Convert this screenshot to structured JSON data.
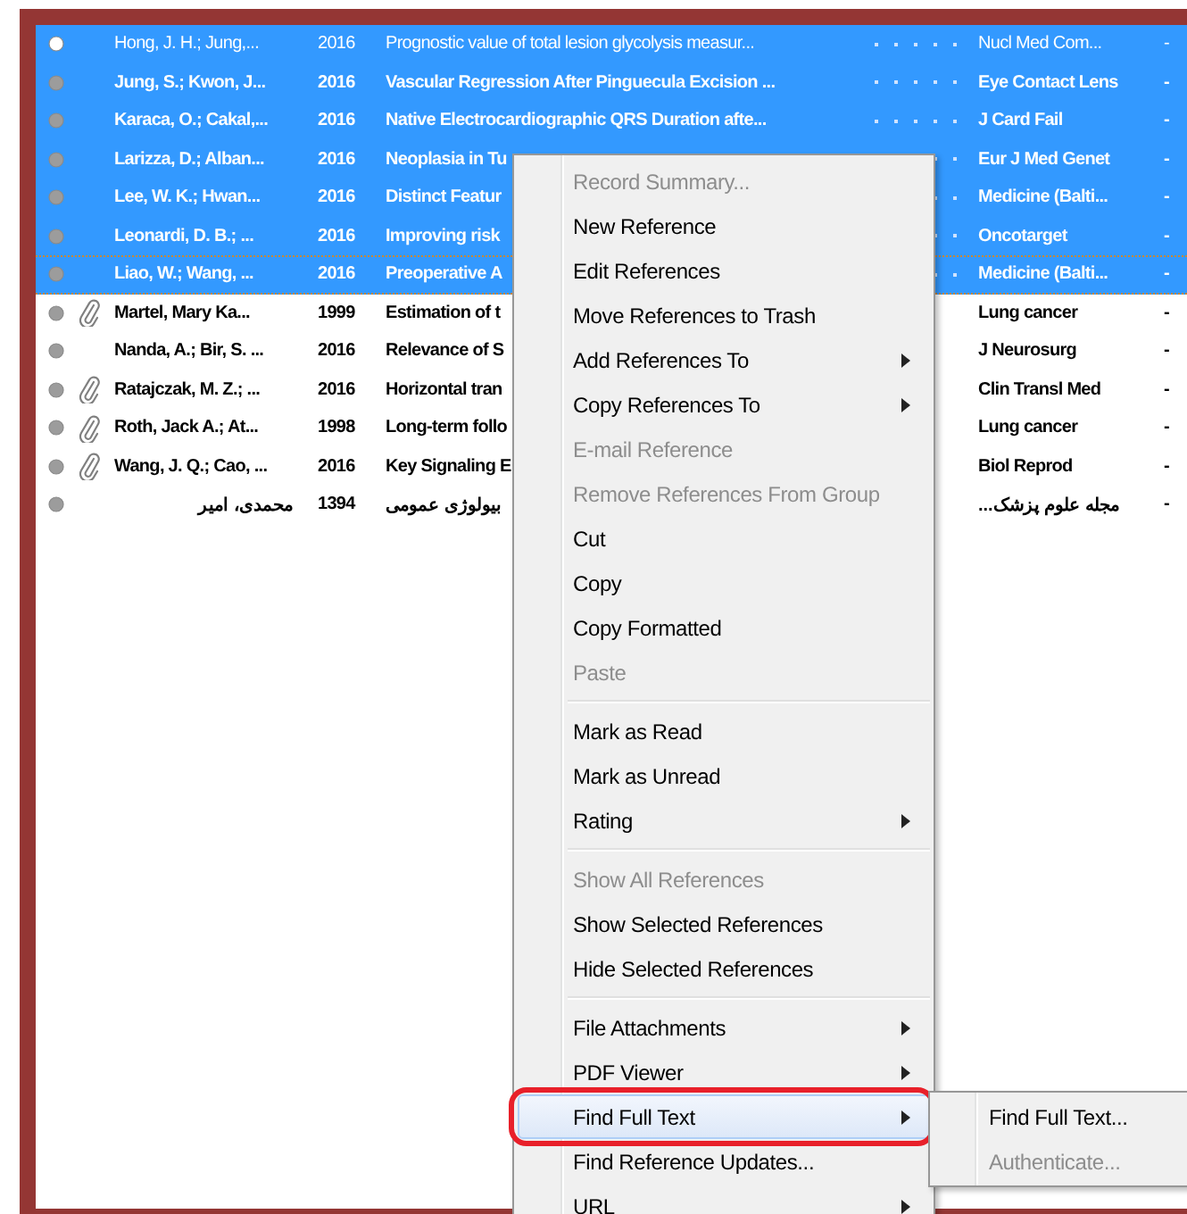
{
  "references": {
    "rows": [
      {
        "read": true,
        "attachment": false,
        "selected": true,
        "focused": false,
        "rtl": false,
        "author": "Hong, J. H.; Jung,...",
        "year": "2016",
        "title": "Prognostic value of total lesion glycolysis measur...",
        "journal": "Nucl Med Com...",
        "column_7": "-"
      },
      {
        "read": false,
        "attachment": false,
        "selected": true,
        "focused": false,
        "rtl": false,
        "author": "Jung, S.; Kwon, J...",
        "year": "2016",
        "title": "Vascular Regression After Pinguecula Excision ...",
        "journal": "Eye Contact Lens",
        "column_7": "-"
      },
      {
        "read": false,
        "attachment": false,
        "selected": true,
        "focused": false,
        "rtl": false,
        "author": "Karaca, O.; Cakal,...",
        "year": "2016",
        "title": "Native Electrocardiographic QRS Duration afte...",
        "journal": "J Card Fail",
        "column_7": "-"
      },
      {
        "read": false,
        "attachment": false,
        "selected": true,
        "focused": false,
        "rtl": false,
        "author": "Larizza, D.; Alban...",
        "year": "2016",
        "title": "Neoplasia in Tu",
        "journal": "Eur J Med Genet",
        "column_7": "-"
      },
      {
        "read": false,
        "attachment": false,
        "selected": true,
        "focused": false,
        "rtl": false,
        "author": "Lee, W. K.; Hwan...",
        "year": "2016",
        "title": "Distinct Featur",
        "journal": "Medicine (Balti...",
        "column_7": "-"
      },
      {
        "read": false,
        "attachment": false,
        "selected": true,
        "focused": false,
        "rtl": false,
        "author": "Leonardi, D. B.; ...",
        "year": "2016",
        "title": "Improving risk",
        "journal": "Oncotarget",
        "column_7": "-"
      },
      {
        "read": false,
        "attachment": false,
        "selected": true,
        "focused": true,
        "rtl": false,
        "author": "Liao, W.; Wang, ...",
        "year": "2016",
        "title": "Preoperative A",
        "journal": "Medicine (Balti...",
        "column_7": "-"
      },
      {
        "read": false,
        "attachment": true,
        "selected": false,
        "focused": false,
        "rtl": false,
        "author": "Martel, Mary Ka...",
        "year": "1999",
        "title": "Estimation of t",
        "journal": "Lung cancer",
        "column_7": "-"
      },
      {
        "read": false,
        "attachment": false,
        "selected": false,
        "focused": false,
        "rtl": false,
        "author": "Nanda, A.; Bir, S. ...",
        "year": "2016",
        "title": "Relevance of S",
        "journal": "J Neurosurg",
        "column_7": "-"
      },
      {
        "read": false,
        "attachment": true,
        "selected": false,
        "focused": false,
        "rtl": false,
        "author": "Ratajczak, M. Z.; ...",
        "year": "2016",
        "title": "Horizontal tran",
        "journal": "Clin Transl Med",
        "column_7": "-"
      },
      {
        "read": false,
        "attachment": true,
        "selected": false,
        "focused": false,
        "rtl": false,
        "author": "Roth, Jack A.; At...",
        "year": "1998",
        "title": "Long-term follo",
        "journal": "Lung cancer",
        "column_7": "-"
      },
      {
        "read": false,
        "attachment": true,
        "selected": false,
        "focused": false,
        "rtl": false,
        "author": "Wang, J. Q.; Cao, ...",
        "year": "2016",
        "title": "Key Signaling E",
        "journal": "Biol Reprod",
        "column_7": "-"
      },
      {
        "read": false,
        "attachment": false,
        "selected": false,
        "focused": false,
        "rtl": true,
        "author": "محمدی، امیر",
        "year": "1394",
        "title": "بیولوژی عمومی",
        "journal": "مجله علوم پزشک...",
        "column_7": "-"
      }
    ]
  },
  "context_menu": {
    "items": [
      {
        "kind": "item",
        "label": "Record Summary...",
        "disabled": true,
        "highlighted": false,
        "annotated": false
      },
      {
        "kind": "item",
        "label": "New Reference",
        "disabled": false,
        "highlighted": false,
        "annotated": false
      },
      {
        "kind": "item",
        "label": "Edit References",
        "disabled": false,
        "highlighted": false,
        "annotated": false
      },
      {
        "kind": "item",
        "label": "Move References to Trash",
        "disabled": false,
        "highlighted": false,
        "annotated": false
      },
      {
        "kind": "submenu",
        "label": "Add References To",
        "disabled": false,
        "highlighted": false,
        "annotated": false
      },
      {
        "kind": "submenu",
        "label": "Copy References To",
        "disabled": false,
        "highlighted": false,
        "annotated": false
      },
      {
        "kind": "item",
        "label": "E-mail Reference",
        "disabled": true,
        "highlighted": false,
        "annotated": false
      },
      {
        "kind": "item",
        "label": "Remove References From Group",
        "disabled": true,
        "highlighted": false,
        "annotated": false
      },
      {
        "kind": "item",
        "label": "Cut",
        "disabled": false,
        "highlighted": false,
        "annotated": false
      },
      {
        "kind": "item",
        "label": "Copy",
        "disabled": false,
        "highlighted": false,
        "annotated": false
      },
      {
        "kind": "item",
        "label": "Copy Formatted",
        "disabled": false,
        "highlighted": false,
        "annotated": false
      },
      {
        "kind": "item",
        "label": "Paste",
        "disabled": true,
        "highlighted": false,
        "annotated": false
      },
      {
        "kind": "separator"
      },
      {
        "kind": "item",
        "label": "Mark as Read",
        "disabled": false,
        "highlighted": false,
        "annotated": false
      },
      {
        "kind": "item",
        "label": "Mark as Unread",
        "disabled": false,
        "highlighted": false,
        "annotated": false
      },
      {
        "kind": "submenu",
        "label": "Rating",
        "disabled": false,
        "highlighted": false,
        "annotated": false
      },
      {
        "kind": "separator"
      },
      {
        "kind": "item",
        "label": "Show All References",
        "disabled": true,
        "highlighted": false,
        "annotated": false
      },
      {
        "kind": "item",
        "label": "Show Selected References",
        "disabled": false,
        "highlighted": false,
        "annotated": false
      },
      {
        "kind": "item",
        "label": "Hide Selected References",
        "disabled": false,
        "highlighted": false,
        "annotated": false
      },
      {
        "kind": "separator"
      },
      {
        "kind": "submenu",
        "label": "File Attachments",
        "disabled": false,
        "highlighted": false,
        "annotated": false
      },
      {
        "kind": "submenu",
        "label": "PDF Viewer",
        "disabled": false,
        "highlighted": false,
        "annotated": false
      },
      {
        "kind": "submenu",
        "label": "Find Full Text",
        "disabled": false,
        "highlighted": true,
        "annotated": true
      },
      {
        "kind": "item",
        "label": "Find Reference Updates...",
        "disabled": false,
        "highlighted": false,
        "annotated": false
      },
      {
        "kind": "submenu",
        "label": "URL",
        "disabled": false,
        "highlighted": false,
        "annotated": false
      }
    ]
  },
  "submenu": {
    "items": [
      {
        "label": "Find Full Text...",
        "disabled": false
      },
      {
        "label": "Authenticate...",
        "disabled": true
      }
    ]
  }
}
